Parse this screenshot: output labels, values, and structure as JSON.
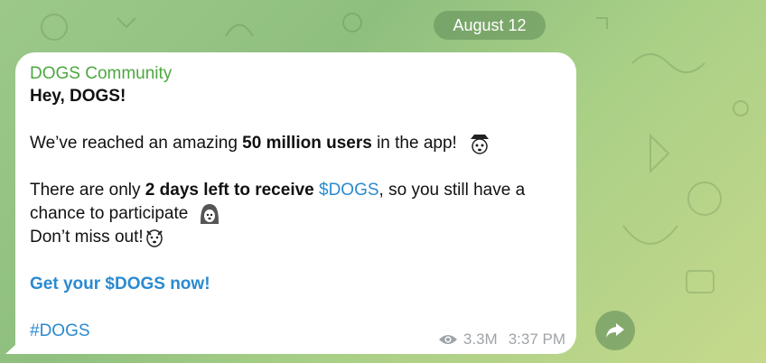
{
  "date_label": "August 12",
  "message": {
    "channel_name": "DOGS Community",
    "greeting": "Hey, DOGS!",
    "line2_pre": "We’ve reached an amazing ",
    "line2_bold": "50 million users",
    "line2_post": " in the app!",
    "line3_pre": "There are only ",
    "line3_bold": "2 days left to receive",
    "line3_space": " ",
    "line3_link": "$DOGS",
    "line3_post": ", so you still have a",
    "line4": "chance to participate",
    "line5": "Don’t miss out!",
    "cta_link": "Get your $DOGS now!",
    "hashtag": "#DOGS"
  },
  "meta": {
    "views": "3.3M",
    "time": "3:37 PM"
  },
  "icons": {
    "views": "eye-icon",
    "share": "share-arrow-icon"
  },
  "colors": {
    "channel": "#4ca83f",
    "link": "#2a8ad0",
    "meta": "#a0a4a8"
  }
}
